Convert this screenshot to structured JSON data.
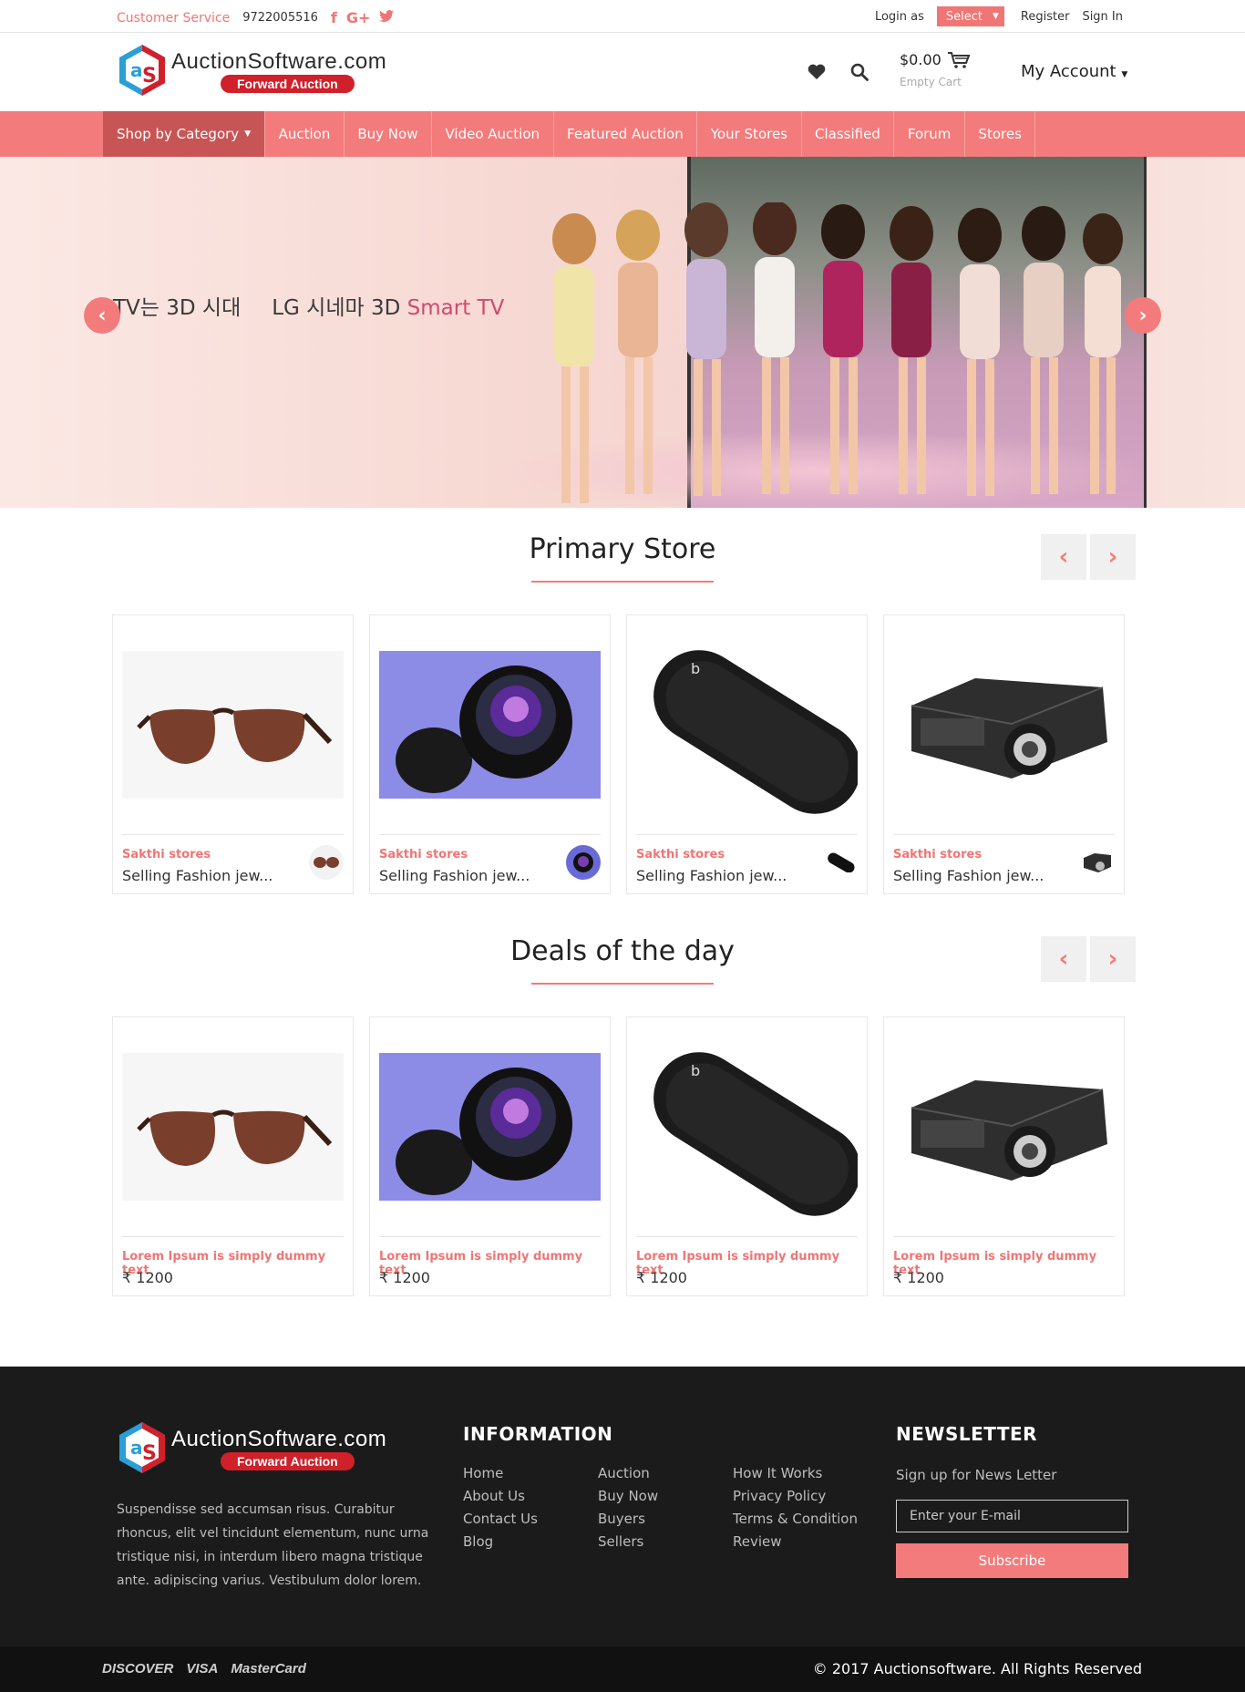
{
  "topbar": {
    "customer_service": "Customer Service",
    "phone": "9722005516",
    "social": [
      "f",
      "G+",
      "t"
    ],
    "login_as": "Login as",
    "select": "Select",
    "register": "Register",
    "sign_in": "Sign In"
  },
  "header": {
    "logo_name": "AuctionSoftware.com",
    "logo_badge": "Forward Auction",
    "cart_amount": "$0.00",
    "cart_status": "Empty Cart",
    "my_account": "My Account"
  },
  "nav": {
    "items": [
      "Shop by Category",
      "Auction",
      "Buy Now",
      "Video Auction",
      "Featured Auction",
      "Your Stores",
      "Classified",
      "Forum",
      "Stores"
    ]
  },
  "hero": {
    "text1": "TV는 3D 시대",
    "text2": "LG 시네마 3D",
    "text3": "Smart TV"
  },
  "primary_store": {
    "title": "Primary Store",
    "cards": [
      {
        "store": "Sakthi stores",
        "desc": "Selling Fashion jew...",
        "image": "sunglasses"
      },
      {
        "store": "Sakthi stores",
        "desc": "Selling Fashion jew...",
        "image": "camera-lens"
      },
      {
        "store": "Sakthi stores",
        "desc": "Selling Fashion jew...",
        "image": "speaker"
      },
      {
        "store": "Sakthi stores",
        "desc": "Selling Fashion jew...",
        "image": "projector"
      }
    ]
  },
  "deals": {
    "title": "Deals of the day",
    "cards": [
      {
        "name": "Lorem Ipsum is simply dummy text",
        "price": "₹ 1200",
        "image": "sunglasses"
      },
      {
        "name": "Lorem Ipsum is simply dummy text",
        "price": "₹ 1200",
        "image": "camera-lens"
      },
      {
        "name": "Lorem Ipsum is simply dummy text",
        "price": "₹ 1200",
        "image": "speaker"
      },
      {
        "name": "Lorem Ipsum is simply dummy text",
        "price": "₹ 1200",
        "image": "projector"
      }
    ]
  },
  "footer": {
    "logo_name": "AuctionSoftware.com",
    "logo_badge": "Forward Auction",
    "about": "Suspendisse sed accumsan risus. Curabitur rhoncus, elit vel tincidunt elementum, nunc urna tristique nisi, in interdum libero magna tristique ante. adipiscing varius. Vestibulum dolor lorem.",
    "info_title": "INFORMATION",
    "col1": [
      "Home",
      "About Us",
      "Contact Us",
      "Blog"
    ],
    "col2": [
      "Auction",
      "Buy Now",
      "Buyers",
      "Sellers"
    ],
    "col3": [
      "How It Works",
      "Privacy Policy",
      "Terms & Condition",
      "Review"
    ],
    "newsletter_title": "NEWSLETTER",
    "newsletter_sub": "Sign up for News Letter",
    "email_placeholder": "Enter your E-mail",
    "subscribe": "Subscribe"
  },
  "bottom": {
    "payments": [
      "DISCOVER",
      "VISA",
      "MasterCard"
    ],
    "copyright": "© 2017 Auctionsoftware. All Rights Reserved"
  },
  "colors": {
    "accent": "#f47b7b",
    "footer_bg": "#1b1b1b",
    "nav_active": "#c85555"
  }
}
